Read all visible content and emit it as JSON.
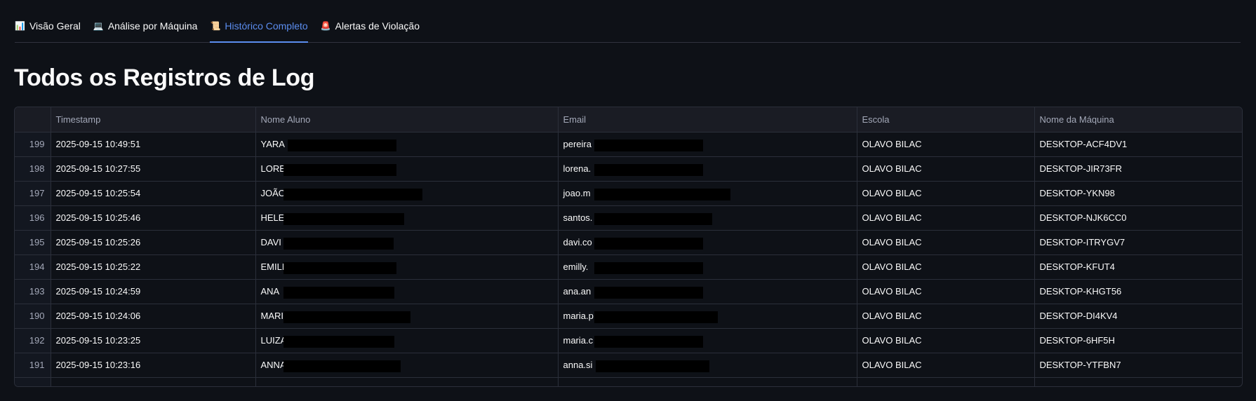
{
  "tabs": [
    {
      "emoji": "📊",
      "label": "Visão Geral",
      "active": false
    },
    {
      "emoji": "💻",
      "label": "Análise por Máquina",
      "active": false
    },
    {
      "emoji": "📜",
      "label": "Histórico Completo",
      "active": true
    },
    {
      "emoji": "🚨",
      "label": "Alertas de Violação",
      "active": false
    }
  ],
  "page_title": "Todos os Registros de Log",
  "table": {
    "columns": [
      "",
      "Timestamp",
      "Nome Aluno",
      "Email",
      "Escola",
      "Nome da Máquina"
    ],
    "rows": [
      {
        "index": "199",
        "timestamp": "2025-09-15 10:49:51",
        "nome": "YARA",
        "email": "pereira",
        "escola": "OLAVO BILAC",
        "maquina": "DESKTOP-ACF4DV1"
      },
      {
        "index": "198",
        "timestamp": "2025-09-15 10:27:55",
        "nome": "LORE",
        "email": "lorena.",
        "escola": "OLAVO BILAC",
        "maquina": "DESKTOP-JIR73FR"
      },
      {
        "index": "197",
        "timestamp": "2025-09-15 10:25:54",
        "nome": "JOÃO",
        "email": "joao.m",
        "escola": "OLAVO BILAC",
        "maquina": "DESKTOP-YKN98"
      },
      {
        "index": "196",
        "timestamp": "2025-09-15 10:25:46",
        "nome": "HELE",
        "email": "santos.",
        "escola": "OLAVO BILAC",
        "maquina": "DESKTOP-NJK6CC0"
      },
      {
        "index": "195",
        "timestamp": "2025-09-15 10:25:26",
        "nome": "DAVI",
        "email": "davi.co",
        "escola": "OLAVO BILAC",
        "maquina": "DESKTOP-ITRYGV7"
      },
      {
        "index": "194",
        "timestamp": "2025-09-15 10:25:22",
        "nome": "EMILL",
        "email": "emilly.",
        "escola": "OLAVO BILAC",
        "maquina": "DESKTOP-KFUT4"
      },
      {
        "index": "193",
        "timestamp": "2025-09-15 10:24:59",
        "nome": "ANA",
        "email": "ana.an",
        "escola": "OLAVO BILAC",
        "maquina": "DESKTOP-KHGT56"
      },
      {
        "index": "190",
        "timestamp": "2025-09-15 10:24:06",
        "nome": "MARI",
        "email": "maria.p",
        "escola": "OLAVO BILAC",
        "maquina": "DESKTOP-DI4KV4"
      },
      {
        "index": "192",
        "timestamp": "2025-09-15 10:23:25",
        "nome": "LUIZA",
        "email": "maria.c",
        "escola": "OLAVO BILAC",
        "maquina": "DESKTOP-6HF5H"
      },
      {
        "index": "191",
        "timestamp": "2025-09-15 10:23:16",
        "nome": "ANNA",
        "email": "anna.si",
        "escola": "OLAVO BILAC",
        "maquina": "DESKTOP-YTFBN7"
      }
    ]
  }
}
